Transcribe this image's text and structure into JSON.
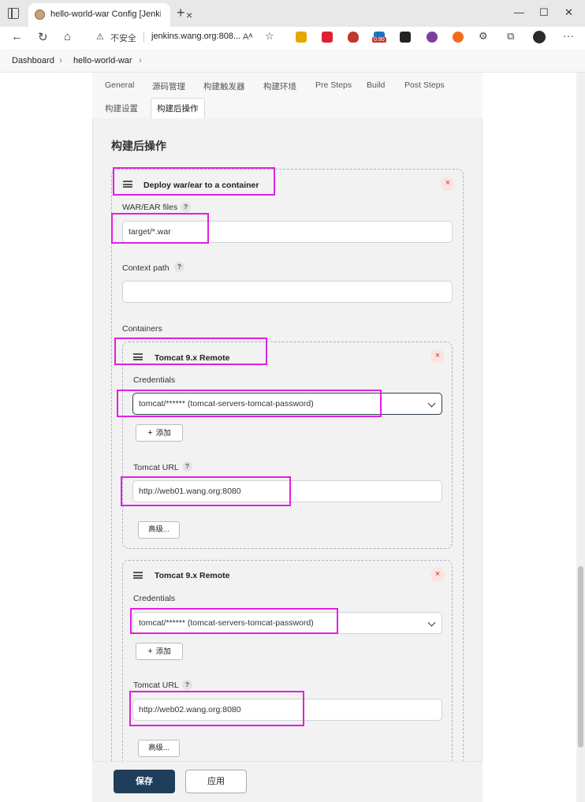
{
  "browser": {
    "tab_title": "hello-world-war Config [Jenkins]",
    "insecure_label": "不安全",
    "url": "jenkins.wang.org:808...",
    "ext_badge": "0.90"
  },
  "breadcrumb": [
    "Dashboard",
    "hello-world-war"
  ],
  "tabs": [
    "General",
    "源码管理",
    "构建触发器",
    "构建环境",
    "Pre Steps",
    "Build",
    "Post Steps",
    "构建设置",
    "构建后操作"
  ],
  "active_tab": "构建后操作",
  "section_title": "构建后操作",
  "deploy": {
    "title": "Deploy war/ear to a container",
    "war_label": "WAR/EAR files",
    "war_value": "target/*.war",
    "context_label": "Context path",
    "context_value": "",
    "containers_label": "Containers",
    "containers": [
      {
        "title": "Tomcat 9.x Remote",
        "credentials_label": "Credentials",
        "credentials_value": "tomcat/****** (tomcat-servers-tomcat-password)",
        "add_label": "添加",
        "url_label": "Tomcat URL",
        "url_value": "http://web01.wang.org:8080",
        "advanced_label": "高级..."
      },
      {
        "title": "Tomcat 9.x Remote",
        "credentials_label": "Credentials",
        "credentials_value": "tomcat/****** (tomcat-servers-tomcat-password)",
        "add_label": "添加",
        "url_label": "Tomcat URL",
        "url_value": "http://web02.wang.org:8080",
        "advanced_label": "高级..."
      }
    ]
  },
  "help_glyph": "?",
  "close_glyph": "×",
  "footer": {
    "save_label": "保存",
    "apply_label": "应用"
  },
  "colors": {
    "highlight": "#e020e0",
    "save_bg": "#1f3e5a"
  }
}
